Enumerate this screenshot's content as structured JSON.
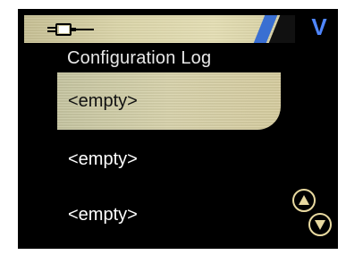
{
  "header": {
    "icon": "plug-icon",
    "right_icon_text": "V"
  },
  "title": "Configuration Log",
  "log_items": [
    {
      "label": "<empty>",
      "selected": true
    },
    {
      "label": "<empty>",
      "selected": false
    },
    {
      "label": "<empty>",
      "selected": false
    }
  ],
  "nav": {
    "up_icon": "arrow-up-icon",
    "down_icon": "arrow-down-icon"
  },
  "colors": {
    "background": "#000000",
    "highlight": "#d9d4ad",
    "accent_blue": "#3a6fd2",
    "button_ring": "#e8d9a0"
  }
}
